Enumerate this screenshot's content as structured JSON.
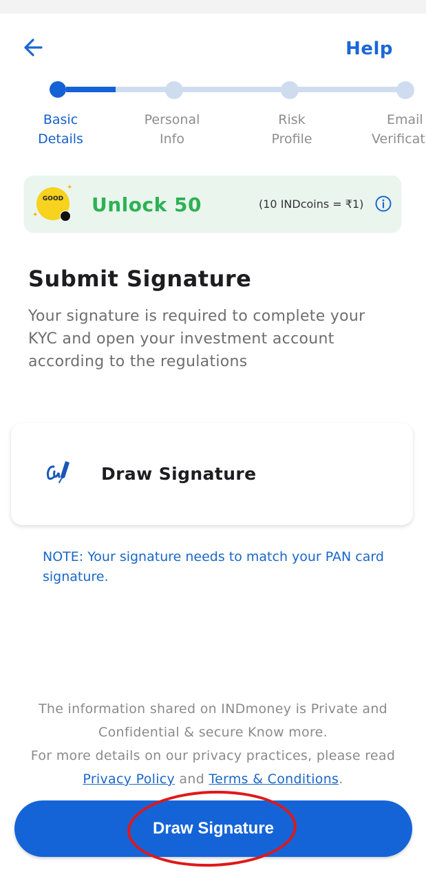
{
  "header": {
    "help_label": "Help"
  },
  "stepper": {
    "steps": [
      {
        "line1": "Basic",
        "line2": "Details",
        "state": "active"
      },
      {
        "line1": "Personal",
        "line2": "Info",
        "state": "pending"
      },
      {
        "line1": "Risk",
        "line2": "Profile",
        "state": "pending"
      },
      {
        "line1": "Email",
        "line2": "Verificati",
        "state": "pending"
      }
    ]
  },
  "unlock": {
    "coin_text": "GOOD",
    "title": "Unlock 50",
    "rate": "(10 INDcoins = ₹1)",
    "icon": "info-icon"
  },
  "main": {
    "title": "Submit Signature",
    "description": "Your signature is required to complete your KYC and open your investment account according to the regulations",
    "option_label": "Draw Signature",
    "option_icon": "signature-pen-icon",
    "note": "NOTE: Your signature needs to match your PAN card signature."
  },
  "footer": {
    "line1": "The information shared on INDmoney is Private and Confidential & secure Know more.",
    "line2": "For more details on our privacy practices, please read",
    "privacy_link": "Privacy Policy",
    "and": "and",
    "terms_link": "Terms & Conditions",
    "period": "."
  },
  "cta": {
    "label": "Draw Signature"
  },
  "colors": {
    "brand": "#1464d8",
    "success": "#2db253",
    "annotation": "#e01818"
  }
}
